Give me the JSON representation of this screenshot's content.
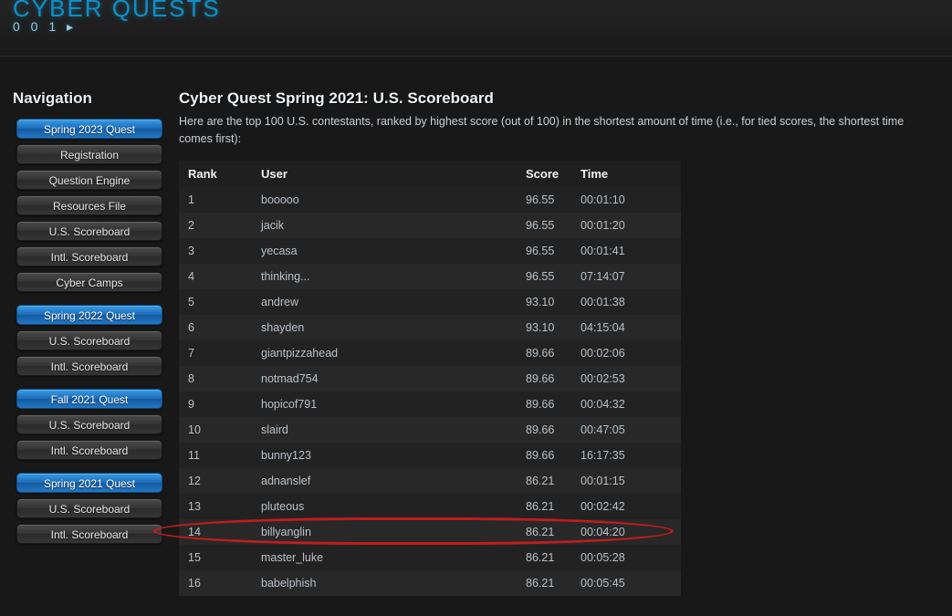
{
  "logo": {
    "top": "CYBER QUESTS",
    "sub": "0 0 1 ▸"
  },
  "nav_title": "Navigation",
  "nav": [
    {
      "header": "Spring 2023 Quest",
      "items": [
        "Registration",
        "Question Engine",
        "Resources File",
        "U.S. Scoreboard",
        "Intl. Scoreboard",
        "Cyber Camps"
      ]
    },
    {
      "header": "Spring 2022 Quest",
      "items": [
        "U.S. Scoreboard",
        "Intl. Scoreboard"
      ]
    },
    {
      "header": "Fall 2021 Quest",
      "items": [
        "U.S. Scoreboard",
        "Intl. Scoreboard"
      ]
    },
    {
      "header": "Spring 2021 Quest",
      "items": [
        "U.S. Scoreboard",
        "Intl. Scoreboard"
      ]
    }
  ],
  "page": {
    "title": "Cyber Quest Spring 2021: U.S. Scoreboard",
    "intro": "Here are the top 100 U.S. contestants, ranked by highest score (out of 100) in the shortest amount of time (i.e., for tied scores, the shortest time comes first):"
  },
  "table": {
    "headers": {
      "rank": "Rank",
      "user": "User",
      "score": "Score",
      "time": "Time"
    },
    "rows": [
      {
        "rank": "1",
        "user": "booooo",
        "score": "96.55",
        "time": "00:01:10"
      },
      {
        "rank": "2",
        "user": "jacik",
        "score": "96.55",
        "time": "00:01:20"
      },
      {
        "rank": "3",
        "user": "yecasa",
        "score": "96.55",
        "time": "00:01:41"
      },
      {
        "rank": "4",
        "user": "thinking...",
        "score": "96.55",
        "time": "07:14:07"
      },
      {
        "rank": "5",
        "user": "andrew",
        "score": "93.10",
        "time": "00:01:38"
      },
      {
        "rank": "6",
        "user": "shayden",
        "score": "93.10",
        "time": "04:15:04"
      },
      {
        "rank": "7",
        "user": "giantpizzahead",
        "score": "89.66",
        "time": "00:02:06"
      },
      {
        "rank": "8",
        "user": "notmad754",
        "score": "89.66",
        "time": "00:02:53"
      },
      {
        "rank": "9",
        "user": "hopicof791",
        "score": "89.66",
        "time": "00:04:32"
      },
      {
        "rank": "10",
        "user": "slaird",
        "score": "89.66",
        "time": "00:47:05"
      },
      {
        "rank": "11",
        "user": "bunny123",
        "score": "89.66",
        "time": "16:17:35"
      },
      {
        "rank": "12",
        "user": "adnanslef",
        "score": "86.21",
        "time": "00:01:15"
      },
      {
        "rank": "13",
        "user": "pluteous",
        "score": "86.21",
        "time": "00:02:42"
      },
      {
        "rank": "14",
        "user": "billyanglin",
        "score": "86.21",
        "time": "00:04:20"
      },
      {
        "rank": "15",
        "user": "master_luke",
        "score": "86.21",
        "time": "00:05:28"
      },
      {
        "rank": "16",
        "user": "babelphish",
        "score": "86.21",
        "time": "00:05:45"
      }
    ],
    "highlight_rank": "14"
  }
}
